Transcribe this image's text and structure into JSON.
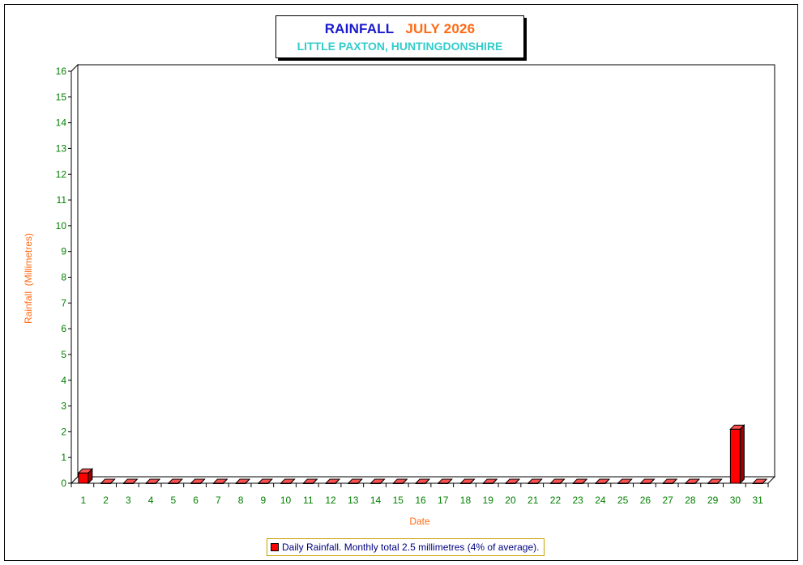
{
  "title": {
    "main": "RAINFALL",
    "period": "JULY 2026",
    "location": "LITTLE PAXTON, HUNTINGDONSHIRE"
  },
  "legend": {
    "label": "Daily Rainfall. Monthly total 2.5 millimetres (4% of average)."
  },
  "colors": {
    "bar_face": "#ff0000",
    "bar_top": "#ff5050",
    "bar_side": "#990000",
    "tick_labels": "#008000",
    "axis_titles": "#ff6a13",
    "title_main": "#1a1acc",
    "title_period": "#ff6a13",
    "title_location": "#33cccc"
  },
  "chart_data": {
    "type": "bar",
    "xlabel": "Date",
    "ylabel": "Rainfall  (Millimetres)",
    "ylim": [
      0,
      16
    ],
    "yticks": [
      0,
      1,
      2,
      3,
      4,
      5,
      6,
      7,
      8,
      9,
      10,
      11,
      12,
      13,
      14,
      15,
      16
    ],
    "grid": true,
    "categories": [
      "1",
      "2",
      "3",
      "4",
      "5",
      "6",
      "7",
      "8",
      "9",
      "10",
      "11",
      "12",
      "13",
      "14",
      "15",
      "16",
      "17",
      "18",
      "19",
      "20",
      "21",
      "22",
      "23",
      "24",
      "25",
      "26",
      "27",
      "28",
      "29",
      "30",
      "31"
    ],
    "series": [
      {
        "values": [
          0.4,
          0,
          0,
          0,
          0,
          0,
          0,
          0,
          0,
          0,
          0,
          0,
          0,
          0,
          0,
          0,
          0,
          0,
          0,
          0,
          0,
          0,
          0,
          0,
          0,
          0,
          0,
          0,
          0,
          2.1,
          0
        ]
      }
    ]
  }
}
